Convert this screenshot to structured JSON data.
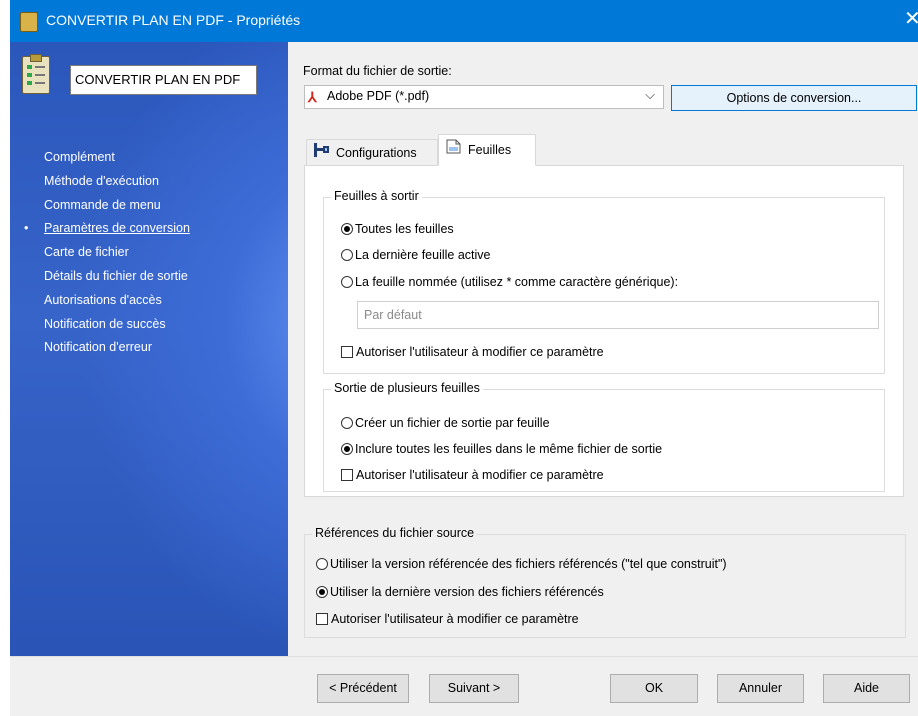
{
  "window": {
    "title": "CONVERTIR PLAN EN PDF - Propriétés",
    "close_glyph": "✕"
  },
  "sidebar": {
    "name_value": "CONVERTIR PLAN EN PDF",
    "items": [
      {
        "label": "Complément"
      },
      {
        "label": "Méthode d'exécution"
      },
      {
        "label": "Commande de menu"
      },
      {
        "label": "Paramètres de conversion",
        "active": true
      },
      {
        "label": "Carte de fichier"
      },
      {
        "label": "Détails du fichier de sortie"
      },
      {
        "label": "Autorisations d'accès"
      },
      {
        "label": "Notification de succès"
      },
      {
        "label": "Notification d'erreur"
      }
    ],
    "bullet": "•"
  },
  "output_format": {
    "label": "Format du fichier de sortie:",
    "value": "Adobe PDF (*.pdf)",
    "options_button": "Options de conversion..."
  },
  "tabs": [
    {
      "label": "Configurations",
      "active": false
    },
    {
      "label": "Feuilles",
      "active": true
    }
  ],
  "sheets_group": {
    "legend": "Feuilles à sortir",
    "opt_all": "Toutes les feuilles",
    "opt_last": "La dernière feuille active",
    "opt_named": "La feuille nommée (utilisez * comme caractère générique):",
    "named_placeholder": "Par défaut",
    "allow_user": "Autoriser l'utilisateur à modifier ce paramètre",
    "selected": "opt_all"
  },
  "multi_group": {
    "legend": "Sortie de plusieurs feuilles",
    "opt_per_sheet": "Créer un fichier de sortie par feuille",
    "opt_same_file": "Inclure toutes les feuilles dans le même fichier de sortie",
    "allow_user": "Autoriser l'utilisateur à modifier ce paramètre",
    "selected": "opt_same_file"
  },
  "refs_group": {
    "legend": "Références du fichier source",
    "opt_as_built": "Utiliser la version référencée des fichiers référencés (\"tel que construit\")",
    "opt_latest": "Utiliser la dernière version des fichiers référencés",
    "allow_user": "Autoriser l'utilisateur à modifier ce paramètre",
    "selected": "opt_latest"
  },
  "buttons": {
    "prev": "< Précédent",
    "next": "Suivant >",
    "ok": "OK",
    "cancel": "Annuler",
    "help": "Aide"
  }
}
